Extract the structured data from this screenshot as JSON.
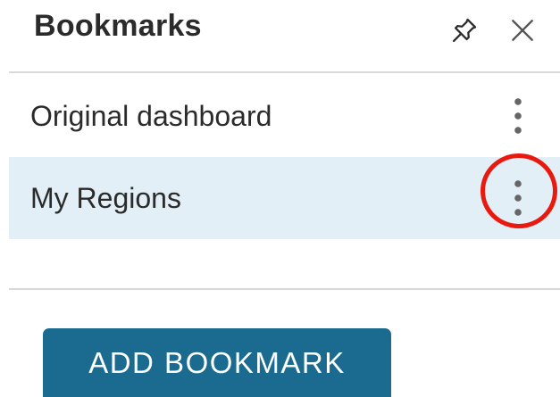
{
  "header": {
    "title": "Bookmarks",
    "pin_icon": "pin-icon",
    "close_icon": "close-icon"
  },
  "bookmarks": [
    {
      "label": "Original dashboard",
      "selected": false,
      "menu_icon": "more-vertical-icon"
    },
    {
      "label": "My Regions",
      "selected": true,
      "menu_icon": "more-vertical-icon",
      "highlighted": true
    }
  ],
  "footer": {
    "add_label": "ADD BOOKMARK"
  },
  "colors": {
    "accent": "#1b6a8f",
    "selected_row": "#e3eff6",
    "highlight_ring": "#e8190e",
    "text": "#2b2b2b"
  }
}
